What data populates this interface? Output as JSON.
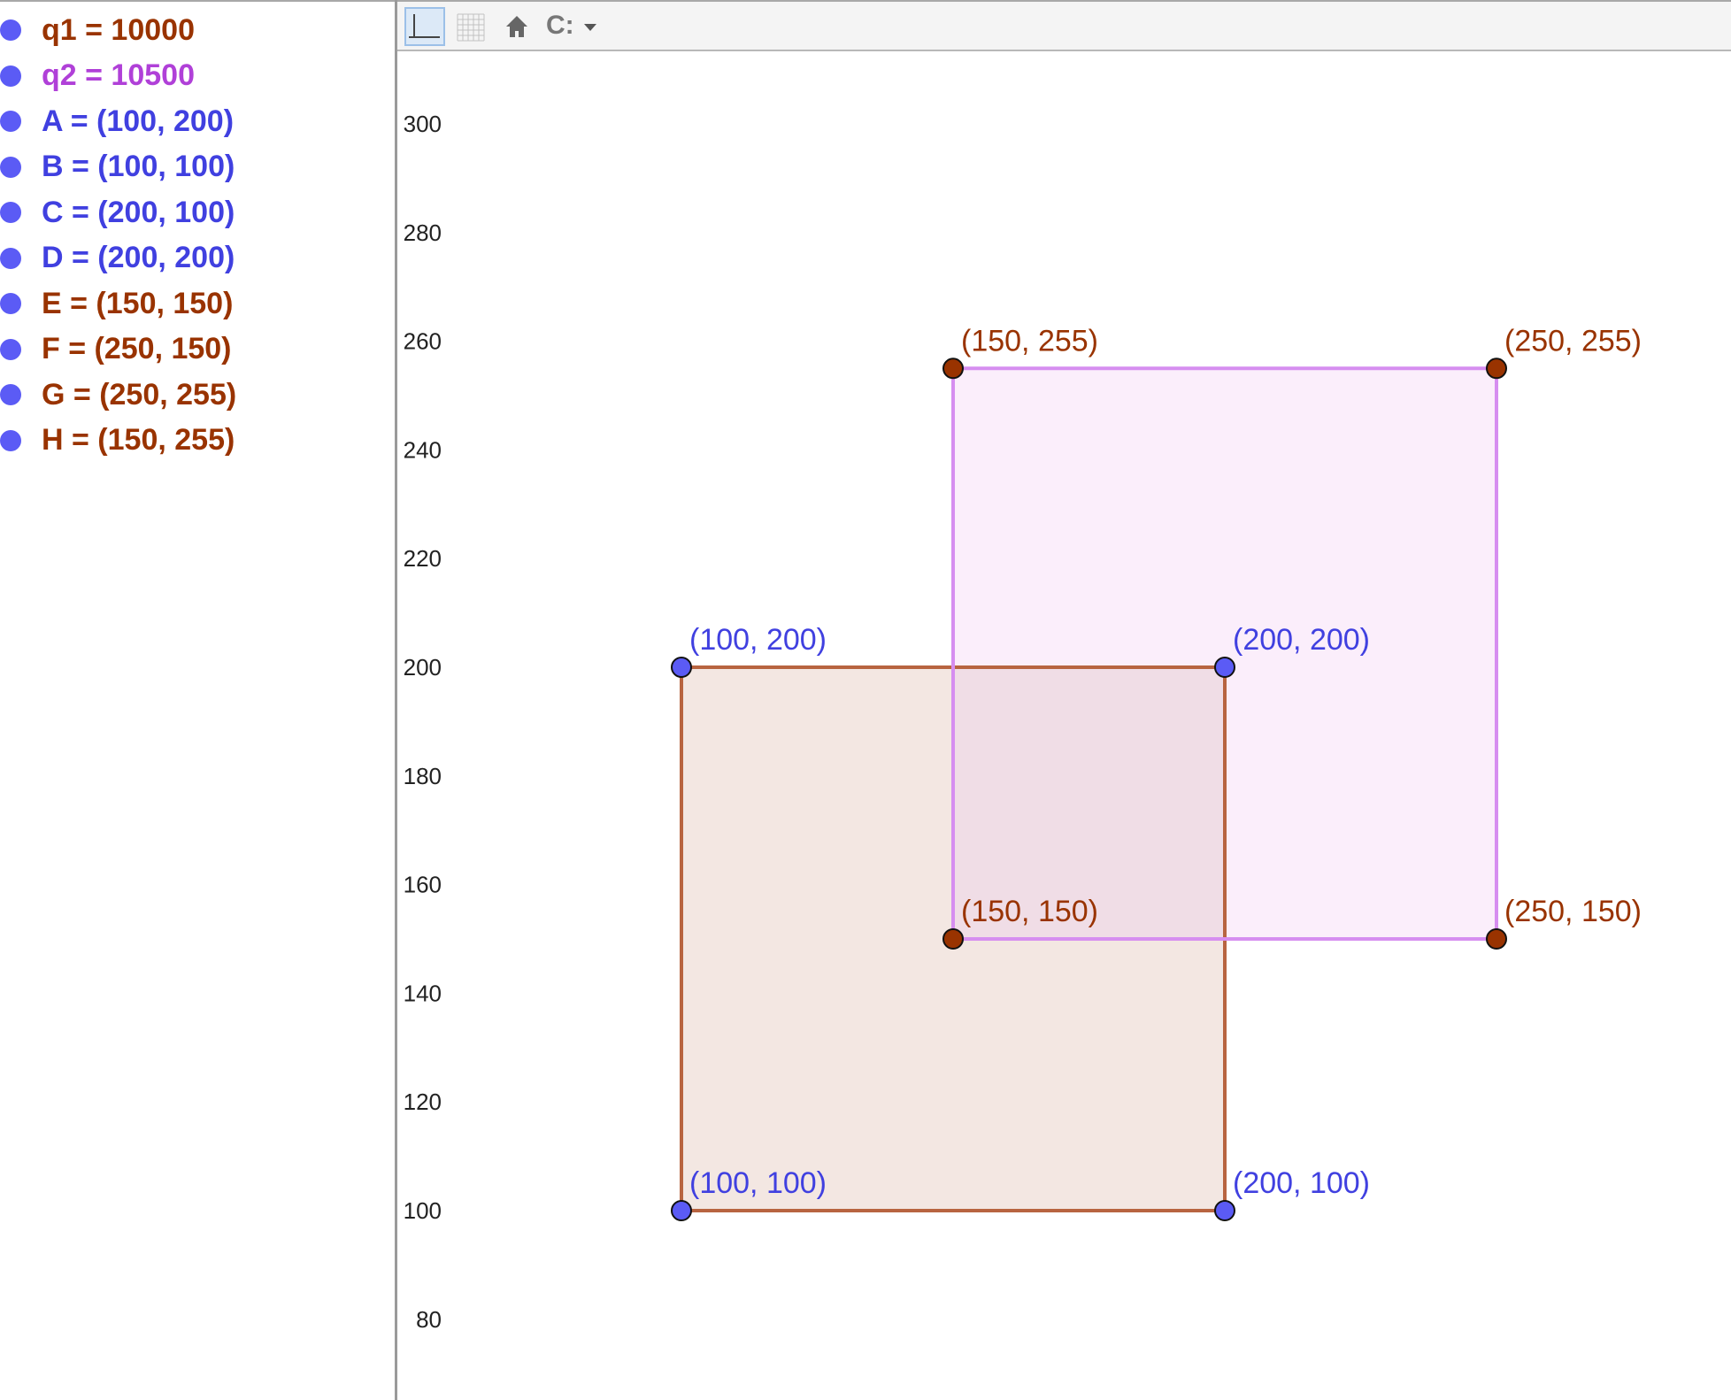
{
  "colors": {
    "blue_point": "#5b5bf5",
    "brown_point": "#993300",
    "brown_text": "#993300",
    "blue_text": "#4040e0",
    "purple_text": "#b040d8",
    "poly1_stroke": "#b86440",
    "poly1_fill": "#f3e7e2",
    "poly2_stroke": "#d68ef0",
    "poly2_fill": "#fbeefb",
    "overlap_fill": "#f0dde6"
  },
  "algebra": {
    "items": [
      {
        "text": "q1 = 10000",
        "color": "#993300",
        "dot": "#5b5bf5"
      },
      {
        "text": "q2 = 10500",
        "color": "#b040d8",
        "dot": "#5b5bf5"
      },
      {
        "text": "A = (100, 200)",
        "color": "#4040e0",
        "dot": "#5b5bf5"
      },
      {
        "text": "B = (100, 100)",
        "color": "#4040e0",
        "dot": "#5b5bf5"
      },
      {
        "text": "C = (200, 100)",
        "color": "#4040e0",
        "dot": "#5b5bf5"
      },
      {
        "text": "D = (200, 200)",
        "color": "#4040e0",
        "dot": "#5b5bf5"
      },
      {
        "text": "E = (150, 150)",
        "color": "#993300",
        "dot": "#5b5bf5"
      },
      {
        "text": "F = (250, 150)",
        "color": "#993300",
        "dot": "#5b5bf5"
      },
      {
        "text": "G = (250, 255)",
        "color": "#993300",
        "dot": "#5b5bf5"
      },
      {
        "text": "H = (150, 255)",
        "color": "#993300",
        "dot": "#5b5bf5"
      }
    ]
  },
  "toolbar": {
    "buttons": [
      {
        "name": "axes-toggle-button",
        "icon": "axes-icon"
      },
      {
        "name": "grid-toggle-button",
        "icon": "grid-icon"
      },
      {
        "name": "standard-view-button",
        "icon": "home-icon"
      },
      {
        "name": "point-capturing-button",
        "icon": "capture-icon",
        "label": "C:"
      }
    ]
  },
  "graphics": {
    "y_ticks": [
      300,
      280,
      260,
      240,
      220,
      200,
      180,
      160,
      140,
      120,
      100,
      80
    ],
    "y_range": [
      70,
      300
    ],
    "points": [
      {
        "id": "A",
        "x": 100,
        "y": 200,
        "label": "(100, 200)",
        "color": "blue"
      },
      {
        "id": "B",
        "x": 100,
        "y": 100,
        "label": "(100, 100)",
        "color": "blue"
      },
      {
        "id": "C",
        "x": 200,
        "y": 100,
        "label": "(200, 100)",
        "color": "blue"
      },
      {
        "id": "D",
        "x": 200,
        "y": 200,
        "label": "(200, 200)",
        "color": "blue"
      },
      {
        "id": "E",
        "x": 150,
        "y": 150,
        "label": "(150, 150)",
        "color": "brown"
      },
      {
        "id": "F",
        "x": 250,
        "y": 150,
        "label": "(250, 150)",
        "color": "brown"
      },
      {
        "id": "G",
        "x": 250,
        "y": 255,
        "label": "(250, 255)",
        "color": "brown"
      },
      {
        "id": "H",
        "x": 150,
        "y": 255,
        "label": "(150, 255)",
        "color": "brown"
      }
    ],
    "polygons": [
      {
        "name": "q1",
        "vertices": [
          "A",
          "B",
          "C",
          "D"
        ],
        "style": "poly1"
      },
      {
        "name": "q2",
        "vertices": [
          "E",
          "F",
          "G",
          "H"
        ],
        "style": "poly2"
      }
    ]
  }
}
